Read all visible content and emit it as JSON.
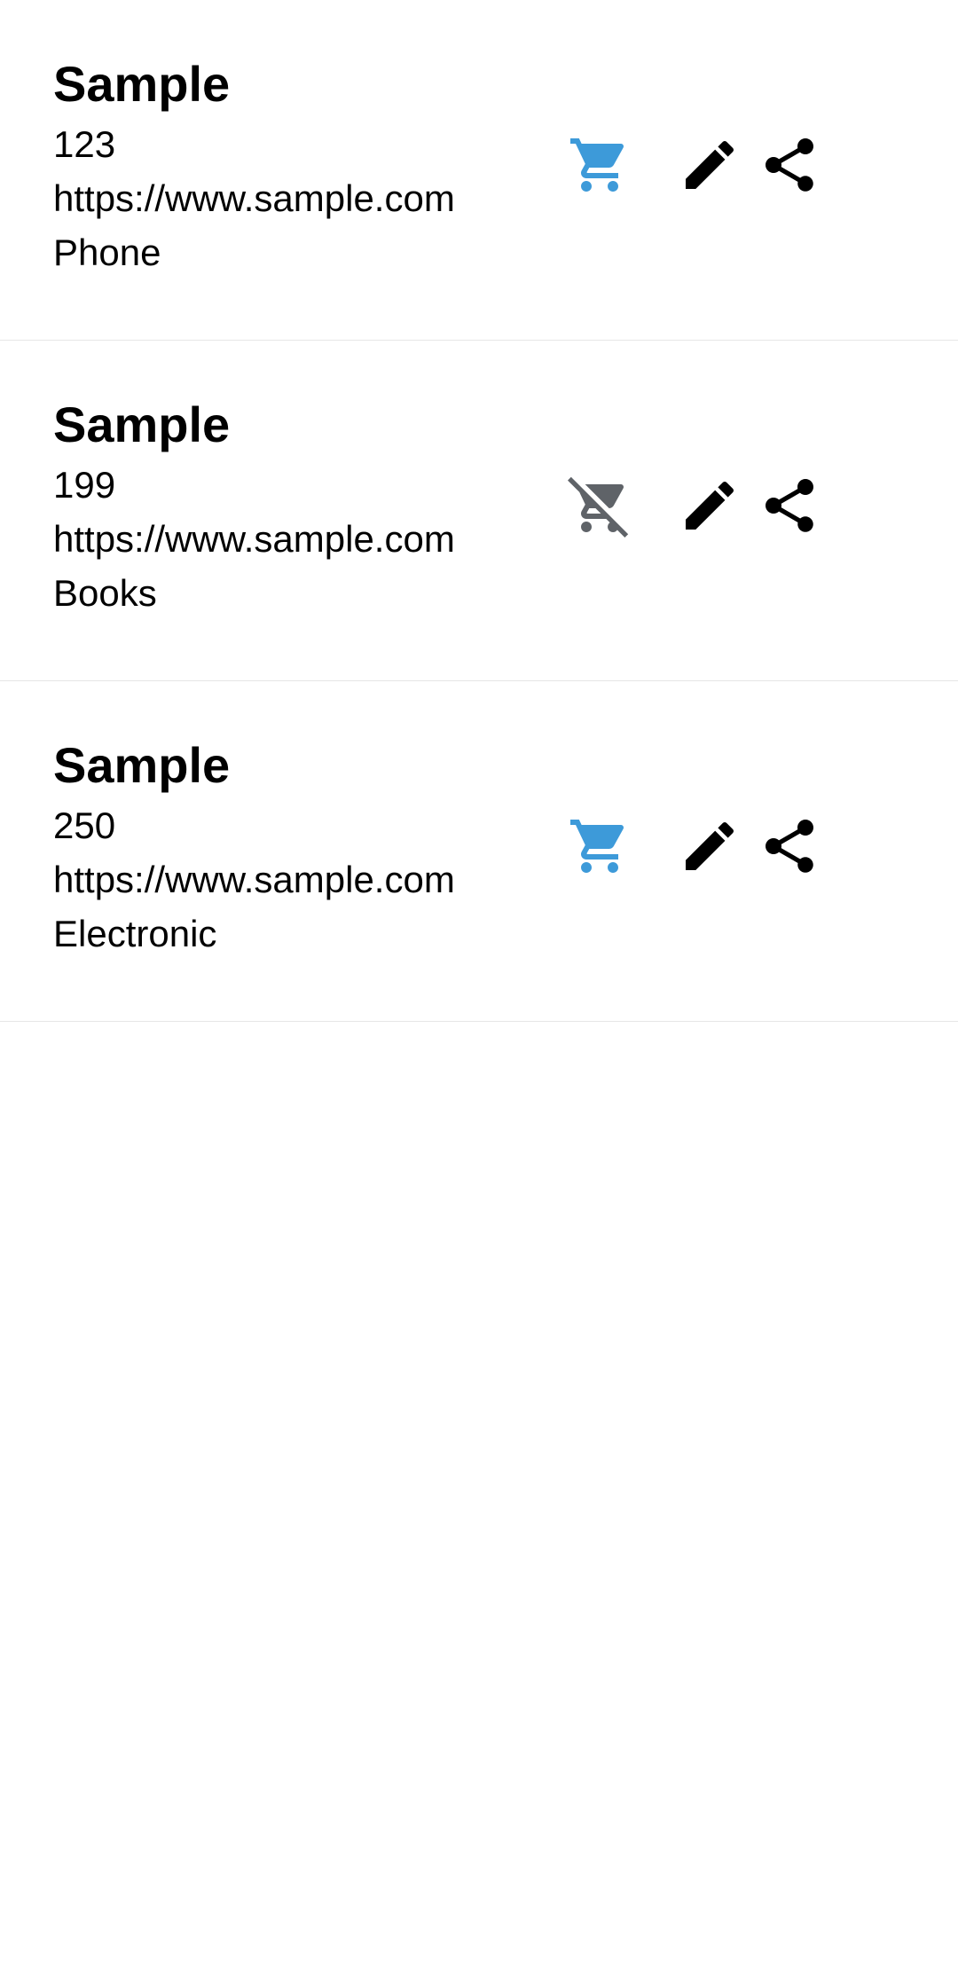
{
  "colors": {
    "cart_active": "#3d9ad9",
    "cart_inactive": "#5f6368",
    "icon_default": "#000000"
  },
  "items": [
    {
      "title": "Sample",
      "price": "123",
      "url": "https://www.sample.com",
      "category": "Phone",
      "cart_icon": "shopping-cart-icon",
      "in_cart": true
    },
    {
      "title": "Sample",
      "price": "199",
      "url": "https://www.sample.com",
      "category": "Books",
      "cart_icon": "remove-shopping-cart-icon",
      "in_cart": false
    },
    {
      "title": "Sample",
      "price": "250",
      "url": "https://www.sample.com",
      "category": "Electronic",
      "cart_icon": "shopping-cart-icon",
      "in_cart": true
    }
  ]
}
